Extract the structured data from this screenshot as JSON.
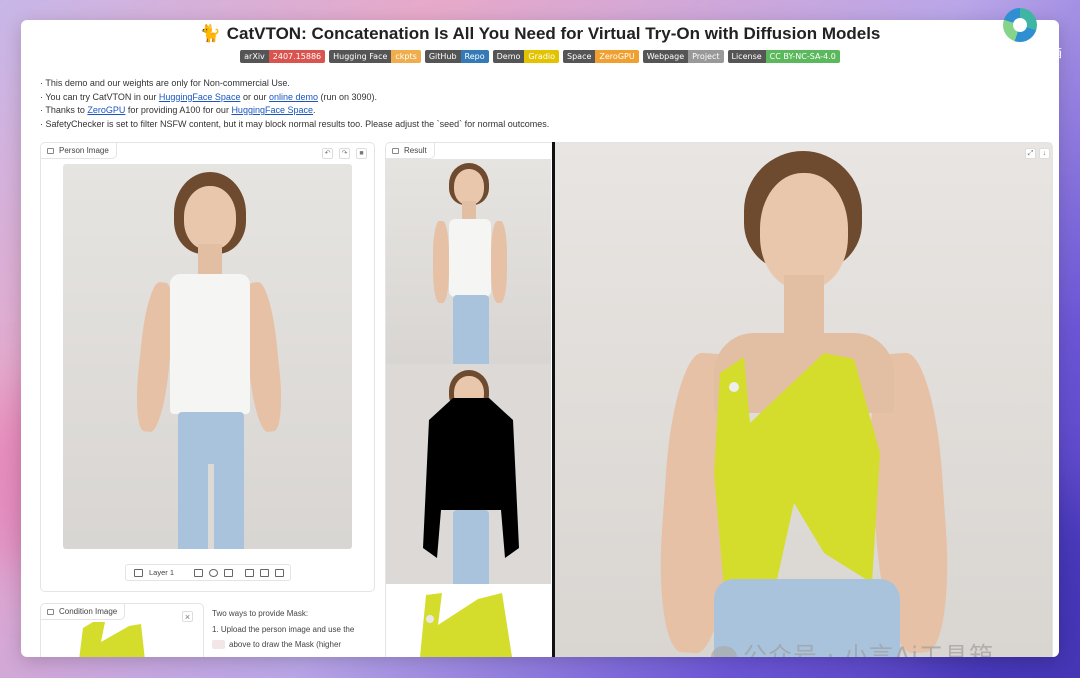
{
  "app": {
    "title_emoji": "🐈",
    "title": "CatVTON: Concatenation Is All You Need for Virtual Try-On with Diffusion Models"
  },
  "badges": [
    {
      "key": "arXiv",
      "value": "2407.15886",
      "color": "#d9534f"
    },
    {
      "key": "Hugging Face",
      "value": "ckpts",
      "color": "#f0ad4e"
    },
    {
      "key": "GitHub",
      "value": "Repo",
      "color": "#337ab7"
    },
    {
      "key": "Demo",
      "value": "Gradio",
      "color": "#e3c300"
    },
    {
      "key": "Space",
      "value": "ZeroGPU",
      "color": "#f0a030"
    },
    {
      "key": "Webpage",
      "value": "Project",
      "color": "#999999"
    },
    {
      "key": "License",
      "value": "CC BY-NC-SA-4.0",
      "color": "#5cb85c"
    }
  ],
  "notes": {
    "line1": "· This demo and our weights are only for Non-commercial Use.",
    "line2_pre": "· You can try CatVTON in our ",
    "line2_link1": "HuggingFace Space",
    "line2_mid": " or our ",
    "line2_link2": "online demo",
    "line2_post": " (run on 3090).",
    "line3_pre": "· Thanks to ",
    "line3_link1": "ZeroGPU",
    "line3_mid": " for providing A100 for our ",
    "line3_link2": "HuggingFace Space",
    "line3_post": ".",
    "line4": "· SafetyChecker is set to filter NSFW content, but it may block normal results too. Please adjust the `seed` for normal outcomes."
  },
  "person_panel": {
    "label": "Person Image",
    "layer_label": "Layer 1"
  },
  "result_panel": {
    "label": "Result"
  },
  "condition_panel": {
    "label": "Condition Image",
    "close": "×"
  },
  "hint": {
    "line1": "Two ways to provide Mask:",
    "line2": "1. Upload the person image and use the",
    "line3": "above to draw the Mask (higher"
  },
  "watermark": "公众号 · 小言Ai工具箱",
  "corner_text": "箱",
  "colors": {
    "garment": "#d4dd2b",
    "link": "#1a55c2"
  }
}
